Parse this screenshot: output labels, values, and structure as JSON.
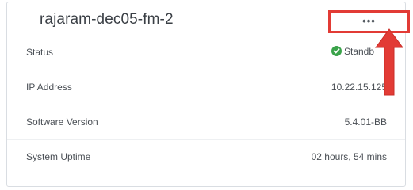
{
  "card": {
    "title": "rajaram-dec05-fm-2",
    "menu_glyph": "•••"
  },
  "rows": [
    {
      "label": "Status",
      "value": "Standb"
    },
    {
      "label": "IP Address",
      "value": "10.22.15.125"
    },
    {
      "label": "Software Version",
      "value": "5.4.01-BB"
    },
    {
      "label": "System Uptime",
      "value": "02 hours, 54 mins"
    }
  ],
  "status_color": "#3aa34a",
  "highlight_color": "#e23b35",
  "icons": {
    "status": "check-circle-icon",
    "menu": "ellipsis-icon",
    "annotation": "arrow-up-icon"
  }
}
